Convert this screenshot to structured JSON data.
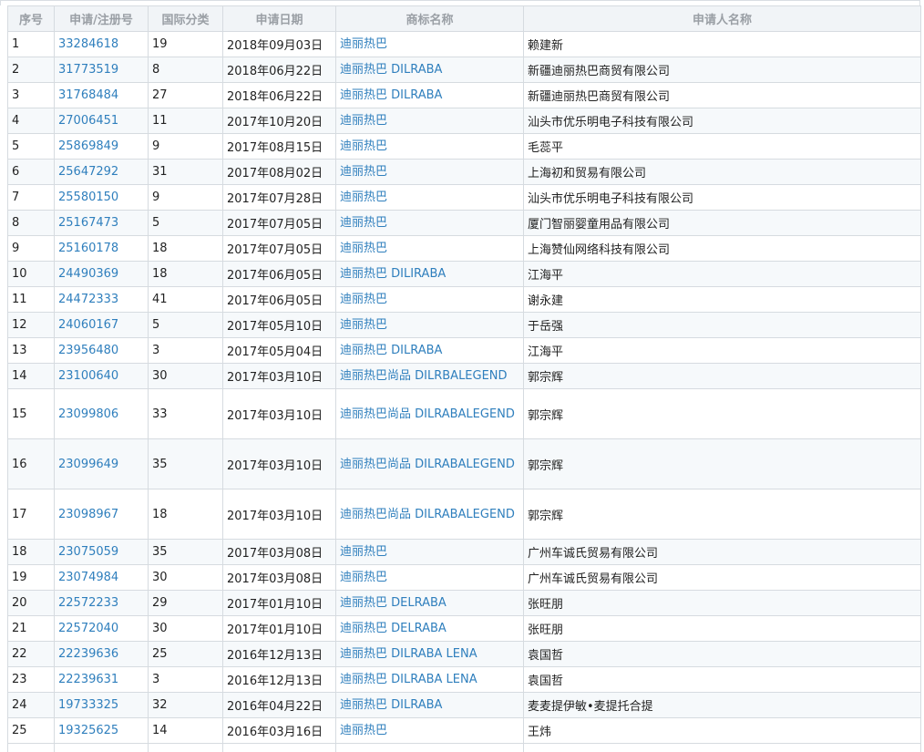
{
  "table": {
    "headers": [
      "序号",
      "申请/注册号",
      "国际分类",
      "申请日期",
      "商标名称",
      "申请人名称"
    ],
    "rows": [
      {
        "idx": "1",
        "reg": "33284618",
        "cls": "19",
        "date": "2018年09月03日",
        "mark": "迪丽热巴",
        "applicant": "赖建新"
      },
      {
        "idx": "2",
        "reg": "31773519",
        "cls": "8",
        "date": "2018年06月22日",
        "mark": "迪丽热巴 DILRABA",
        "applicant": "新疆迪丽热巴商贸有限公司"
      },
      {
        "idx": "3",
        "reg": "31768484",
        "cls": "27",
        "date": "2018年06月22日",
        "mark": "迪丽热巴 DILRABA",
        "applicant": "新疆迪丽热巴商贸有限公司"
      },
      {
        "idx": "4",
        "reg": "27006451",
        "cls": "11",
        "date": "2017年10月20日",
        "mark": "迪丽热巴",
        "applicant": "汕头市优乐明电子科技有限公司"
      },
      {
        "idx": "5",
        "reg": "25869849",
        "cls": "9",
        "date": "2017年08月15日",
        "mark": "迪丽热巴",
        "applicant": "毛蕊平"
      },
      {
        "idx": "6",
        "reg": "25647292",
        "cls": "31",
        "date": "2017年08月02日",
        "mark": "迪丽热巴",
        "applicant": "上海初和贸易有限公司"
      },
      {
        "idx": "7",
        "reg": "25580150",
        "cls": "9",
        "date": "2017年07月28日",
        "mark": "迪丽热巴",
        "applicant": "汕头市优乐明电子科技有限公司"
      },
      {
        "idx": "8",
        "reg": "25167473",
        "cls": "5",
        "date": "2017年07月05日",
        "mark": "迪丽热巴",
        "applicant": "厦门智丽婴童用品有限公司"
      },
      {
        "idx": "9",
        "reg": "25160178",
        "cls": "18",
        "date": "2017年07月05日",
        "mark": "迪丽热巴",
        "applicant": "上海赞仙网络科技有限公司"
      },
      {
        "idx": "10",
        "reg": "24490369",
        "cls": "18",
        "date": "2017年06月05日",
        "mark": "迪丽热巴 DILIRABA",
        "applicant": "江海平"
      },
      {
        "idx": "11",
        "reg": "24472333",
        "cls": "41",
        "date": "2017年06月05日",
        "mark": "迪丽热巴",
        "applicant": "谢永建"
      },
      {
        "idx": "12",
        "reg": "24060167",
        "cls": "5",
        "date": "2017年05月10日",
        "mark": "迪丽热巴",
        "applicant": "于岳强"
      },
      {
        "idx": "13",
        "reg": "23956480",
        "cls": "3",
        "date": "2017年05月04日",
        "mark": "迪丽热巴 DILRABA",
        "applicant": "江海平"
      },
      {
        "idx": "14",
        "reg": "23100640",
        "cls": "30",
        "date": "2017年03月10日",
        "mark": "迪丽热巴尚品 DILRBALEGEND",
        "applicant": "郭宗辉"
      },
      {
        "idx": "15",
        "reg": "23099806",
        "cls": "33",
        "date": "2017年03月10日",
        "mark": "迪丽热巴尚品 DILRABALEGEND",
        "applicant": "郭宗辉",
        "tall": true
      },
      {
        "idx": "16",
        "reg": "23099649",
        "cls": "35",
        "date": "2017年03月10日",
        "mark": "迪丽热巴尚品 DILRABALEGEND",
        "applicant": "郭宗辉",
        "tall": true
      },
      {
        "idx": "17",
        "reg": "23098967",
        "cls": "18",
        "date": "2017年03月10日",
        "mark": "迪丽热巴尚品 DILRABALEGEND",
        "applicant": "郭宗辉",
        "tall": true
      },
      {
        "idx": "18",
        "reg": "23075059",
        "cls": "35",
        "date": "2017年03月08日",
        "mark": "迪丽热巴",
        "applicant": "广州车诚氏贸易有限公司"
      },
      {
        "idx": "19",
        "reg": "23074984",
        "cls": "30",
        "date": "2017年03月08日",
        "mark": "迪丽热巴",
        "applicant": "广州车诚氏贸易有限公司"
      },
      {
        "idx": "20",
        "reg": "22572233",
        "cls": "29",
        "date": "2017年01月10日",
        "mark": "迪丽热巴 DELRABA",
        "applicant": "张旺朋"
      },
      {
        "idx": "21",
        "reg": "22572040",
        "cls": "30",
        "date": "2017年01月10日",
        "mark": "迪丽热巴 DELRABA",
        "applicant": "张旺朋"
      },
      {
        "idx": "22",
        "reg": "22239636",
        "cls": "25",
        "date": "2016年12月13日",
        "mark": "迪丽热巴 DILRABA LENA",
        "applicant": "袁国哲"
      },
      {
        "idx": "23",
        "reg": "22239631",
        "cls": "3",
        "date": "2016年12月13日",
        "mark": "迪丽热巴 DILRABA LENA",
        "applicant": "袁国哲"
      },
      {
        "idx": "24",
        "reg": "19733325",
        "cls": "32",
        "date": "2016年04月22日",
        "mark": "迪丽热巴 DILRABA",
        "applicant": "麦麦提伊敏•麦提托合提"
      },
      {
        "idx": "25",
        "reg": "19325625",
        "cls": "14",
        "date": "2016年03月16日",
        "mark": "迪丽热巴",
        "applicant": "王炜"
      }
    ]
  },
  "colors": {
    "link": "#2f7fbd",
    "header_bg": "#f1f4f7",
    "stripe": "#f6f9fb",
    "border": "#d6dbe0"
  }
}
